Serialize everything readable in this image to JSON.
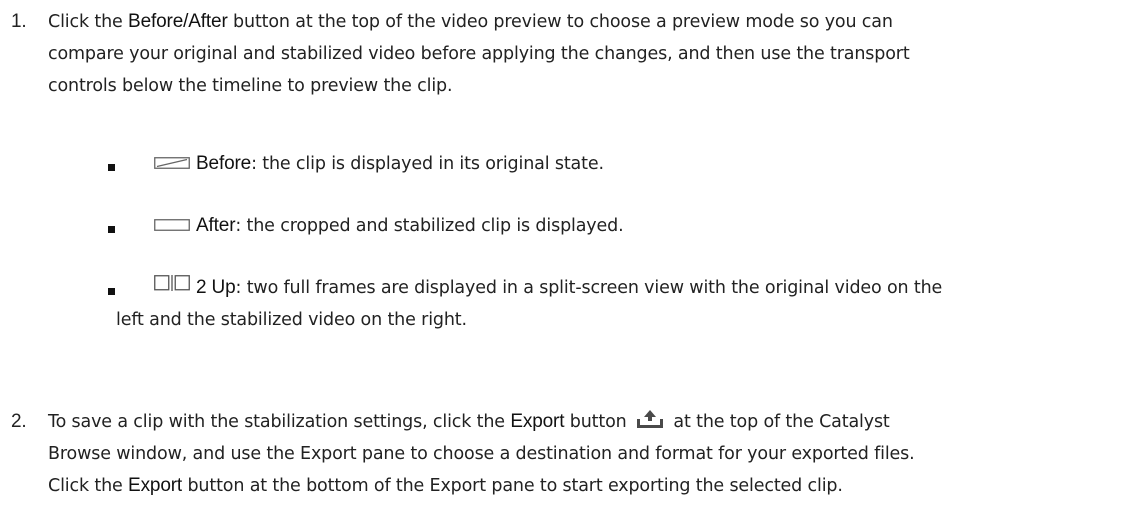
{
  "step1": {
    "number": "1.",
    "text_a": "Click the ",
    "bold_a": "Before/After",
    "text_b": " button at the top of the video preview to choose a preview mode so you can",
    "line2": "compare your original and stabilized video before applying the changes, and then use the transport",
    "line3": "controls below the timeline to preview the clip."
  },
  "bullets": [
    {
      "icon": "before-mode-icon",
      "label": "Before",
      "text": ": the clip is displayed in its original state."
    },
    {
      "icon": "after-mode-icon",
      "label": "After",
      "text": ": the cropped and stabilized clip is displayed."
    },
    {
      "icon": "two-up-mode-icon",
      "label": "2 Up",
      "text": ": two full frames are displayed in a split-screen view with the original video on the",
      "line2": "left and the stabilized video on the right."
    }
  ],
  "step2": {
    "number": "2.",
    "text_a": "To save a clip with the stabilization settings, click the ",
    "bold_a": "Export",
    "text_b": " button ",
    "icon": "export-icon",
    "text_c": " at the top of the Catalyst",
    "line2": "Browse window, and use the Export pane to choose a destination and format for your exported files.",
    "line3_a": "Click the ",
    "bold_b": "Export",
    "line3_b": " button at the bottom of the Export pane to start exporting the selected clip."
  }
}
